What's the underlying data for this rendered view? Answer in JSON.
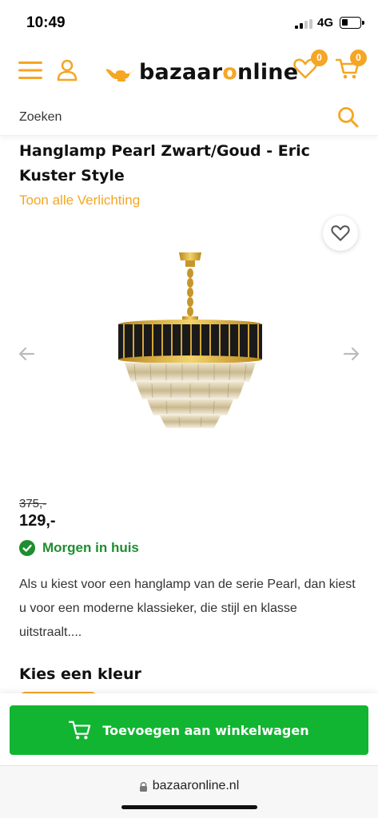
{
  "status": {
    "time": "10:49",
    "network": "4G"
  },
  "header": {
    "logo_prefix": "bazaar",
    "logo_accent": "o",
    "logo_suffix": "nline",
    "wishlist_count": "0",
    "cart_count": "0"
  },
  "search": {
    "placeholder": "Zoeken"
  },
  "product": {
    "title": "Hanglamp Pearl Zwart/Goud - Eric Kuster Style",
    "category_link": "Toon alle Verlichting",
    "old_price": "375,-",
    "price": "129,-",
    "delivery": "Morgen in huis",
    "description": "Als u kiest voor een hanglamp van de serie Pearl, dan kiest u voor een moderne klassieker, die stijl en klasse uitstraalt...."
  },
  "color_section": {
    "heading": "Kies een kleur"
  },
  "cart_button": {
    "label": "Toevoegen aan winkelwagen"
  },
  "browser": {
    "url": "bazaaronline.nl"
  },
  "colors": {
    "accent": "#f5a623",
    "success": "#1e8e2e",
    "button_green": "#12b532"
  },
  "icons": [
    "menu-icon",
    "user-icon",
    "genie-lamp-logo-icon",
    "heart-icon",
    "cart-icon",
    "search-icon",
    "arrow-left-icon",
    "arrow-right-icon",
    "check-circle-icon",
    "lock-icon"
  ]
}
